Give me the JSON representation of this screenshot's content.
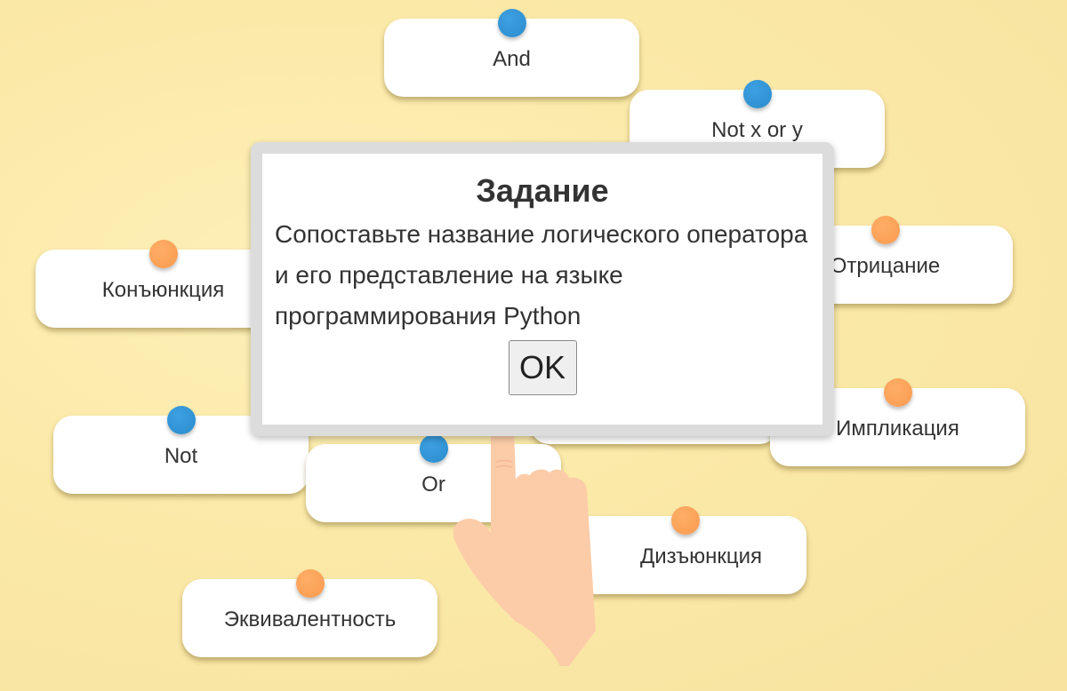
{
  "cards": [
    {
      "label": "And",
      "dot": "blue"
    },
    {
      "label": "Not x or y",
      "dot": "blue"
    },
    {
      "label": "Конъюнкция",
      "dot": "orange"
    },
    {
      "label": "Отрицание",
      "dot": "orange"
    },
    {
      "label": "Not",
      "dot": "blue"
    },
    {
      "label": "Or",
      "dot": "blue"
    },
    {
      "label": "Импликация",
      "dot": "orange"
    },
    {
      "label": "Дизъюнкция",
      "dot": "orange"
    },
    {
      "label": "Эквивалентность",
      "dot": "orange"
    },
    {
      "label": "",
      "dot": ""
    }
  ],
  "colors": {
    "dot_blue": "#2b8ccc",
    "dot_orange": "#f99a50",
    "hand": "#fccca8"
  },
  "modal": {
    "title": "Задание",
    "text": "Сопоставьте название логического оператора и его представление на языке программирования Python",
    "ok_label": "OK"
  }
}
